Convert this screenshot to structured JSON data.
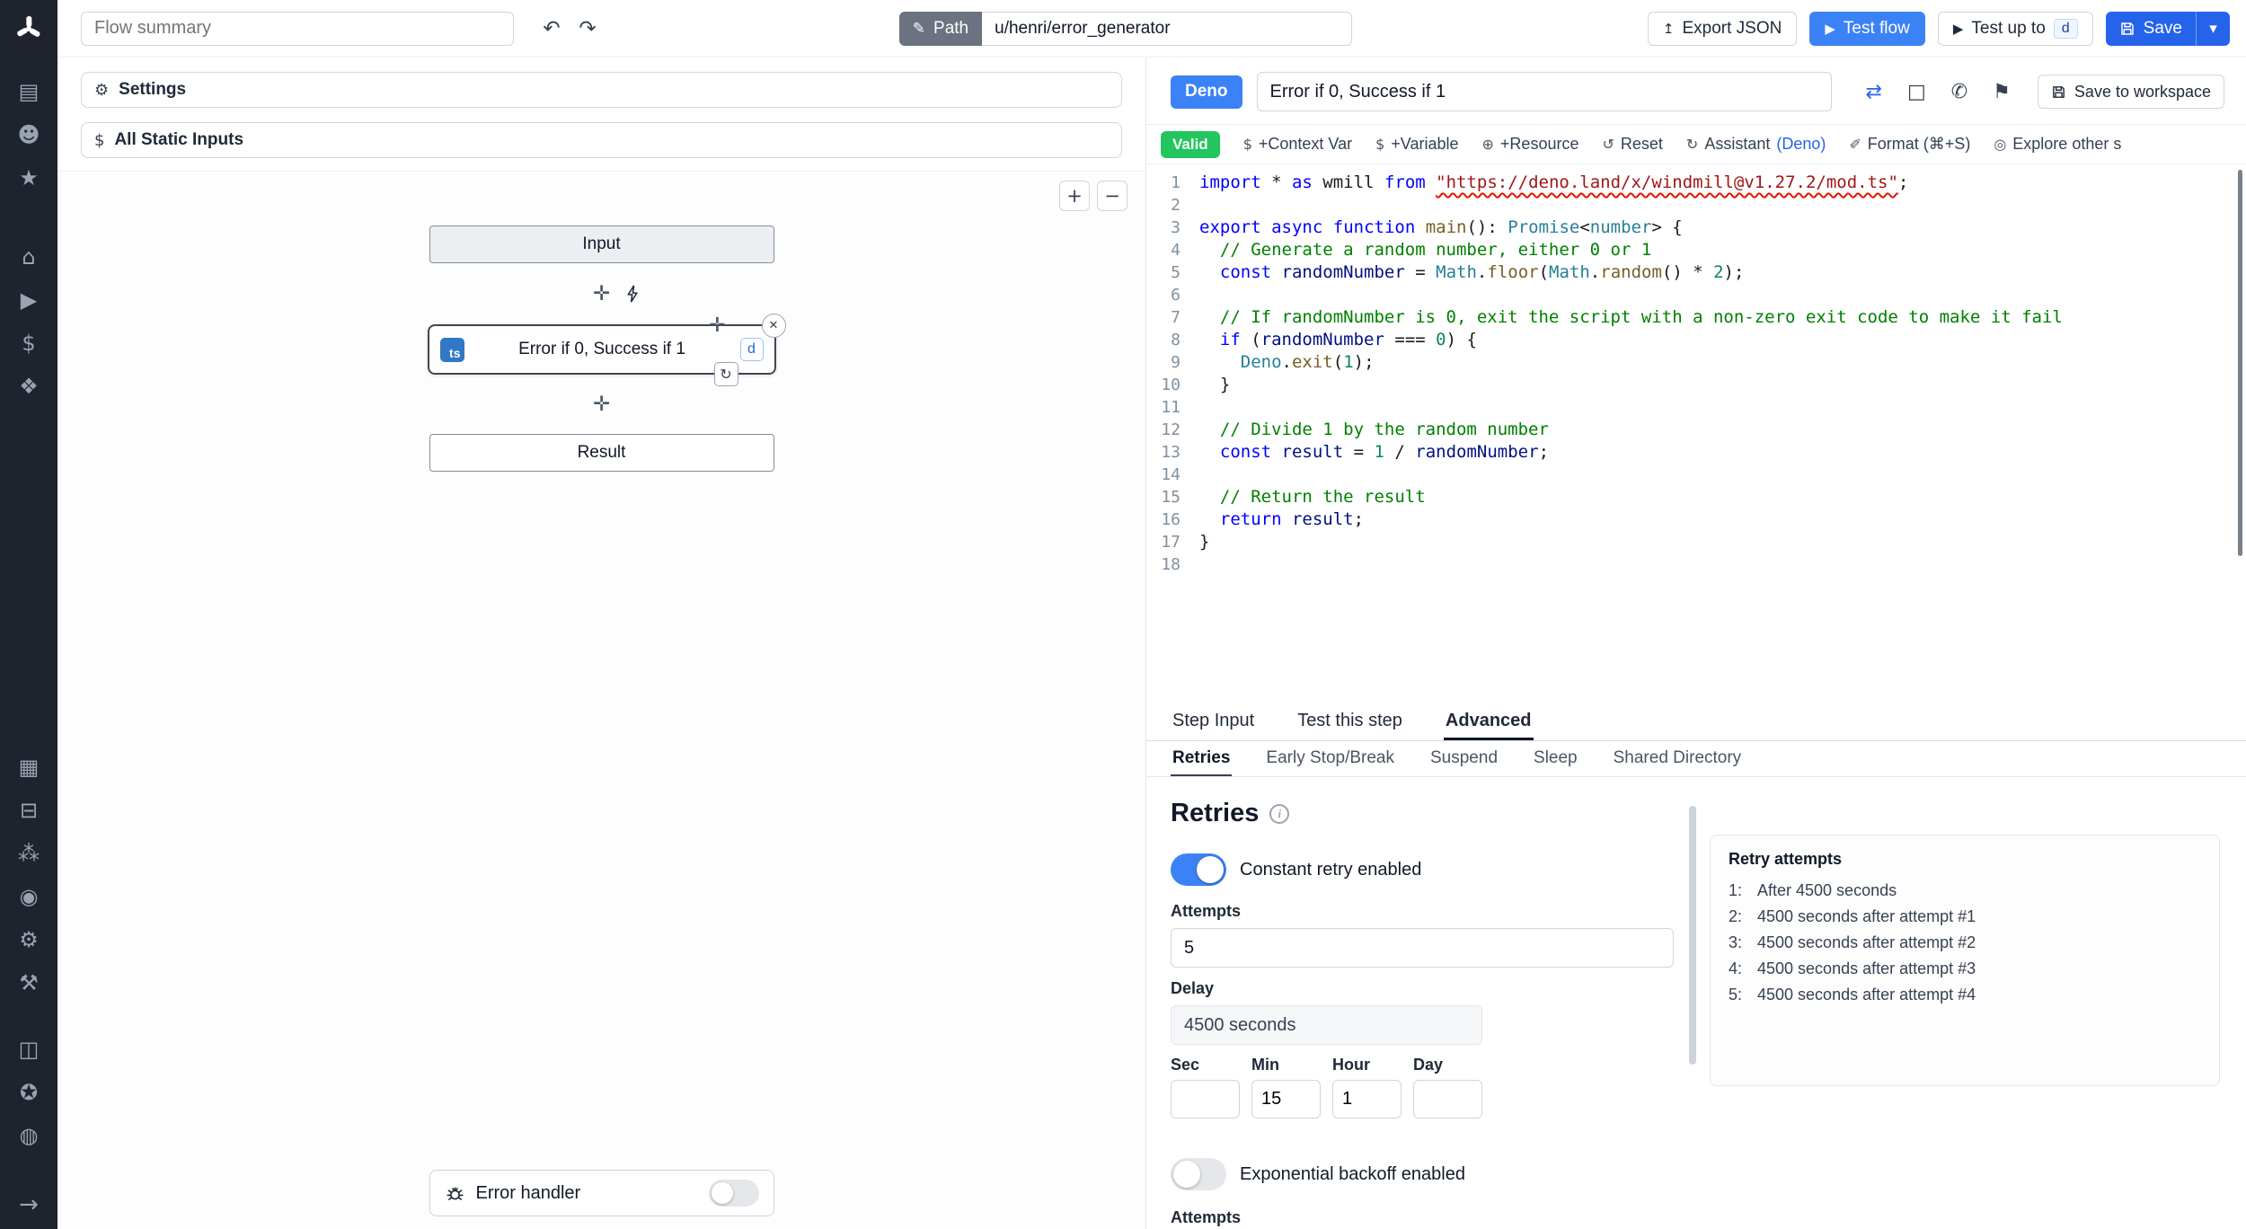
{
  "colors": {
    "accent": "#3b82f6",
    "save": "#2563eb",
    "valid": "#22c55e",
    "sidebar": "#1f232d",
    "ts_badge": "#3178c6"
  },
  "sidebar": {
    "groups": [
      [
        {
          "name": "runs-icon",
          "glyph": "▤"
        },
        {
          "name": "user-icon",
          "glyph": "☻"
        },
        {
          "name": "favorites-icon",
          "glyph": "★"
        }
      ],
      [
        {
          "name": "home-icon",
          "glyph": "⌂"
        },
        {
          "name": "jobs-icon",
          "glyph": "▶"
        },
        {
          "name": "variables-icon",
          "glyph": "$"
        },
        {
          "name": "resources-icon",
          "glyph": "❖"
        }
      ],
      [
        {
          "name": "schedules-icon",
          "glyph": "▦"
        },
        {
          "name": "folders-icon",
          "glyph": "⊟"
        },
        {
          "name": "groups-icon",
          "glyph": "⁂"
        },
        {
          "name": "audit-logs-icon",
          "glyph": "◉"
        },
        {
          "name": "settings-icon",
          "glyph": "⚙"
        },
        {
          "name": "workers-icon",
          "glyph": "⚒"
        }
      ],
      [
        {
          "name": "docs-icon",
          "glyph": "◫"
        },
        {
          "name": "discord-icon",
          "glyph": "✪"
        },
        {
          "name": "github-icon",
          "glyph": "◍"
        }
      ]
    ],
    "expand_glyph": "→"
  },
  "topbar": {
    "flow_summary_placeholder": "Flow summary",
    "undo_glyph": "↶",
    "redo_glyph": "↷",
    "path_label": "Path",
    "path_value": "u/henri/error_generator",
    "export_json_label": "Export JSON",
    "test_flow_label": "Test flow",
    "test_up_to_label": "Test up to",
    "test_up_to_key": "d",
    "save_label": "Save"
  },
  "left_panel": {
    "settings_label": "Settings",
    "static_inputs_label": "All Static Inputs",
    "zoom_in": "+",
    "zoom_out": "−",
    "graph": {
      "input_label": "Input",
      "step_label": "Error if 0, Success if 1",
      "step_lang_badge": "ts",
      "step_shortcut": "d",
      "result_label": "Result"
    },
    "error_handler_label": "Error handler"
  },
  "right_panel": {
    "lang_badge": "Deno",
    "step_name_value": "Error if 0, Success if 1",
    "save_to_workspace_label": "Save to workspace",
    "toolbar": {
      "valid_label": "Valid",
      "items": [
        {
          "name": "add-context-var",
          "icon": "$",
          "label": "+Context Var"
        },
        {
          "name": "add-variable",
          "icon": "$",
          "label": "+Variable"
        },
        {
          "name": "add-resource",
          "icon": "⊕",
          "label": "+Resource"
        },
        {
          "name": "reset",
          "icon": "↺",
          "label": "Reset"
        },
        {
          "name": "assistant",
          "icon": "↻",
          "label": "Assistant",
          "suffix": "(Deno)"
        },
        {
          "name": "format",
          "icon": "✐",
          "label": "Format (⌘+S)"
        },
        {
          "name": "explore-scripts",
          "icon": "◎",
          "label": "Explore other s"
        }
      ]
    },
    "tabs": [
      {
        "label": "Step Input",
        "active": false
      },
      {
        "label": "Test this step",
        "active": false
      },
      {
        "label": "Advanced",
        "active": true
      }
    ],
    "subtabs": [
      {
        "label": "Retries",
        "active": true
      },
      {
        "label": "Early Stop/Break",
        "active": false
      },
      {
        "label": "Suspend",
        "active": false
      },
      {
        "label": "Sleep",
        "active": false
      },
      {
        "label": "Shared Directory",
        "active": false
      }
    ],
    "retries": {
      "title": "Retries",
      "constant_toggle_label": "Constant retry enabled",
      "attempts_label": "Attempts",
      "attempts_value": "5",
      "delay_label": "Delay",
      "delay_value": "4500 seconds",
      "time_fields": [
        {
          "label": "Sec",
          "value": ""
        },
        {
          "label": "Min",
          "value": "15"
        },
        {
          "label": "Hour",
          "value": "1"
        },
        {
          "label": "Day",
          "value": ""
        }
      ],
      "exponential_toggle_label": "Exponential backoff enabled",
      "bottom_cut_label": "Attempts",
      "preview": {
        "title": "Retry attempts",
        "items": [
          {
            "n": "1:",
            "text": "After 4500 seconds"
          },
          {
            "n": "2:",
            "text": "4500 seconds after attempt #1"
          },
          {
            "n": "3:",
            "text": "4500 seconds after attempt #2"
          },
          {
            "n": "4:",
            "text": "4500 seconds after attempt #3"
          },
          {
            "n": "5:",
            "text": "4500 seconds after attempt #4"
          }
        ]
      }
    }
  },
  "editor": {
    "lines": [
      [
        {
          "c": "k",
          "t": "import"
        },
        {
          "c": "p",
          "t": " * "
        },
        {
          "c": "k",
          "t": "as"
        },
        {
          "c": "p",
          "t": " wmill "
        },
        {
          "c": "k",
          "t": "from"
        },
        {
          "c": "p",
          "t": " "
        },
        {
          "c": "s sq",
          "t": "\"https://deno.land/x/windmill@v1.27.2/mod.ts\""
        },
        {
          "c": "p",
          "t": ";"
        }
      ],
      [],
      [
        {
          "c": "k",
          "t": "export"
        },
        {
          "c": "p",
          "t": " "
        },
        {
          "c": "b",
          "t": "async"
        },
        {
          "c": "p",
          "t": " "
        },
        {
          "c": "b",
          "t": "function"
        },
        {
          "c": "p",
          "t": " "
        },
        {
          "c": "f",
          "t": "main"
        },
        {
          "c": "p",
          "t": "(): "
        },
        {
          "c": "t",
          "t": "Promise"
        },
        {
          "c": "p",
          "t": "<"
        },
        {
          "c": "t",
          "t": "number"
        },
        {
          "c": "p",
          "t": "> {"
        }
      ],
      [
        {
          "c": "c",
          "t": "  // Generate a random number, either 0 or 1"
        }
      ],
      [
        {
          "c": "p",
          "t": "  "
        },
        {
          "c": "b",
          "t": "const"
        },
        {
          "c": "p",
          "t": " "
        },
        {
          "c": "v",
          "t": "randomNumber"
        },
        {
          "c": "p",
          "t": " = "
        },
        {
          "c": "t",
          "t": "Math"
        },
        {
          "c": "p",
          "t": "."
        },
        {
          "c": "f",
          "t": "floor"
        },
        {
          "c": "p",
          "t": "("
        },
        {
          "c": "t",
          "t": "Math"
        },
        {
          "c": "p",
          "t": "."
        },
        {
          "c": "f",
          "t": "random"
        },
        {
          "c": "p",
          "t": "() * "
        },
        {
          "c": "n",
          "t": "2"
        },
        {
          "c": "p",
          "t": ");"
        }
      ],
      [],
      [
        {
          "c": "c",
          "t": "  // If randomNumber is 0, exit the script with a non-zero exit code to make it fail"
        }
      ],
      [
        {
          "c": "p",
          "t": "  "
        },
        {
          "c": "k",
          "t": "if"
        },
        {
          "c": "p",
          "t": " ("
        },
        {
          "c": "v",
          "t": "randomNumber"
        },
        {
          "c": "p",
          "t": " === "
        },
        {
          "c": "n",
          "t": "0"
        },
        {
          "c": "p",
          "t": ") {"
        }
      ],
      [
        {
          "c": "p",
          "t": "    "
        },
        {
          "c": "t",
          "t": "Deno"
        },
        {
          "c": "p",
          "t": "."
        },
        {
          "c": "f",
          "t": "exit"
        },
        {
          "c": "p",
          "t": "("
        },
        {
          "c": "n",
          "t": "1"
        },
        {
          "c": "p",
          "t": ");"
        }
      ],
      [
        {
          "c": "p",
          "t": "  }"
        }
      ],
      [],
      [
        {
          "c": "c",
          "t": "  // Divide 1 by the random number"
        }
      ],
      [
        {
          "c": "p",
          "t": "  "
        },
        {
          "c": "b",
          "t": "const"
        },
        {
          "c": "p",
          "t": " "
        },
        {
          "c": "v",
          "t": "result"
        },
        {
          "c": "p",
          "t": " = "
        },
        {
          "c": "n",
          "t": "1"
        },
        {
          "c": "p",
          "t": " / "
        },
        {
          "c": "v",
          "t": "randomNumber"
        },
        {
          "c": "p",
          "t": ";"
        }
      ],
      [],
      [
        {
          "c": "c",
          "t": "  // Return the result"
        }
      ],
      [
        {
          "c": "p",
          "t": "  "
        },
        {
          "c": "k",
          "t": "return"
        },
        {
          "c": "p",
          "t": " "
        },
        {
          "c": "v",
          "t": "result"
        },
        {
          "c": "p",
          "t": ";"
        }
      ],
      [
        {
          "c": "p",
          "t": "}"
        }
      ],
      []
    ]
  }
}
